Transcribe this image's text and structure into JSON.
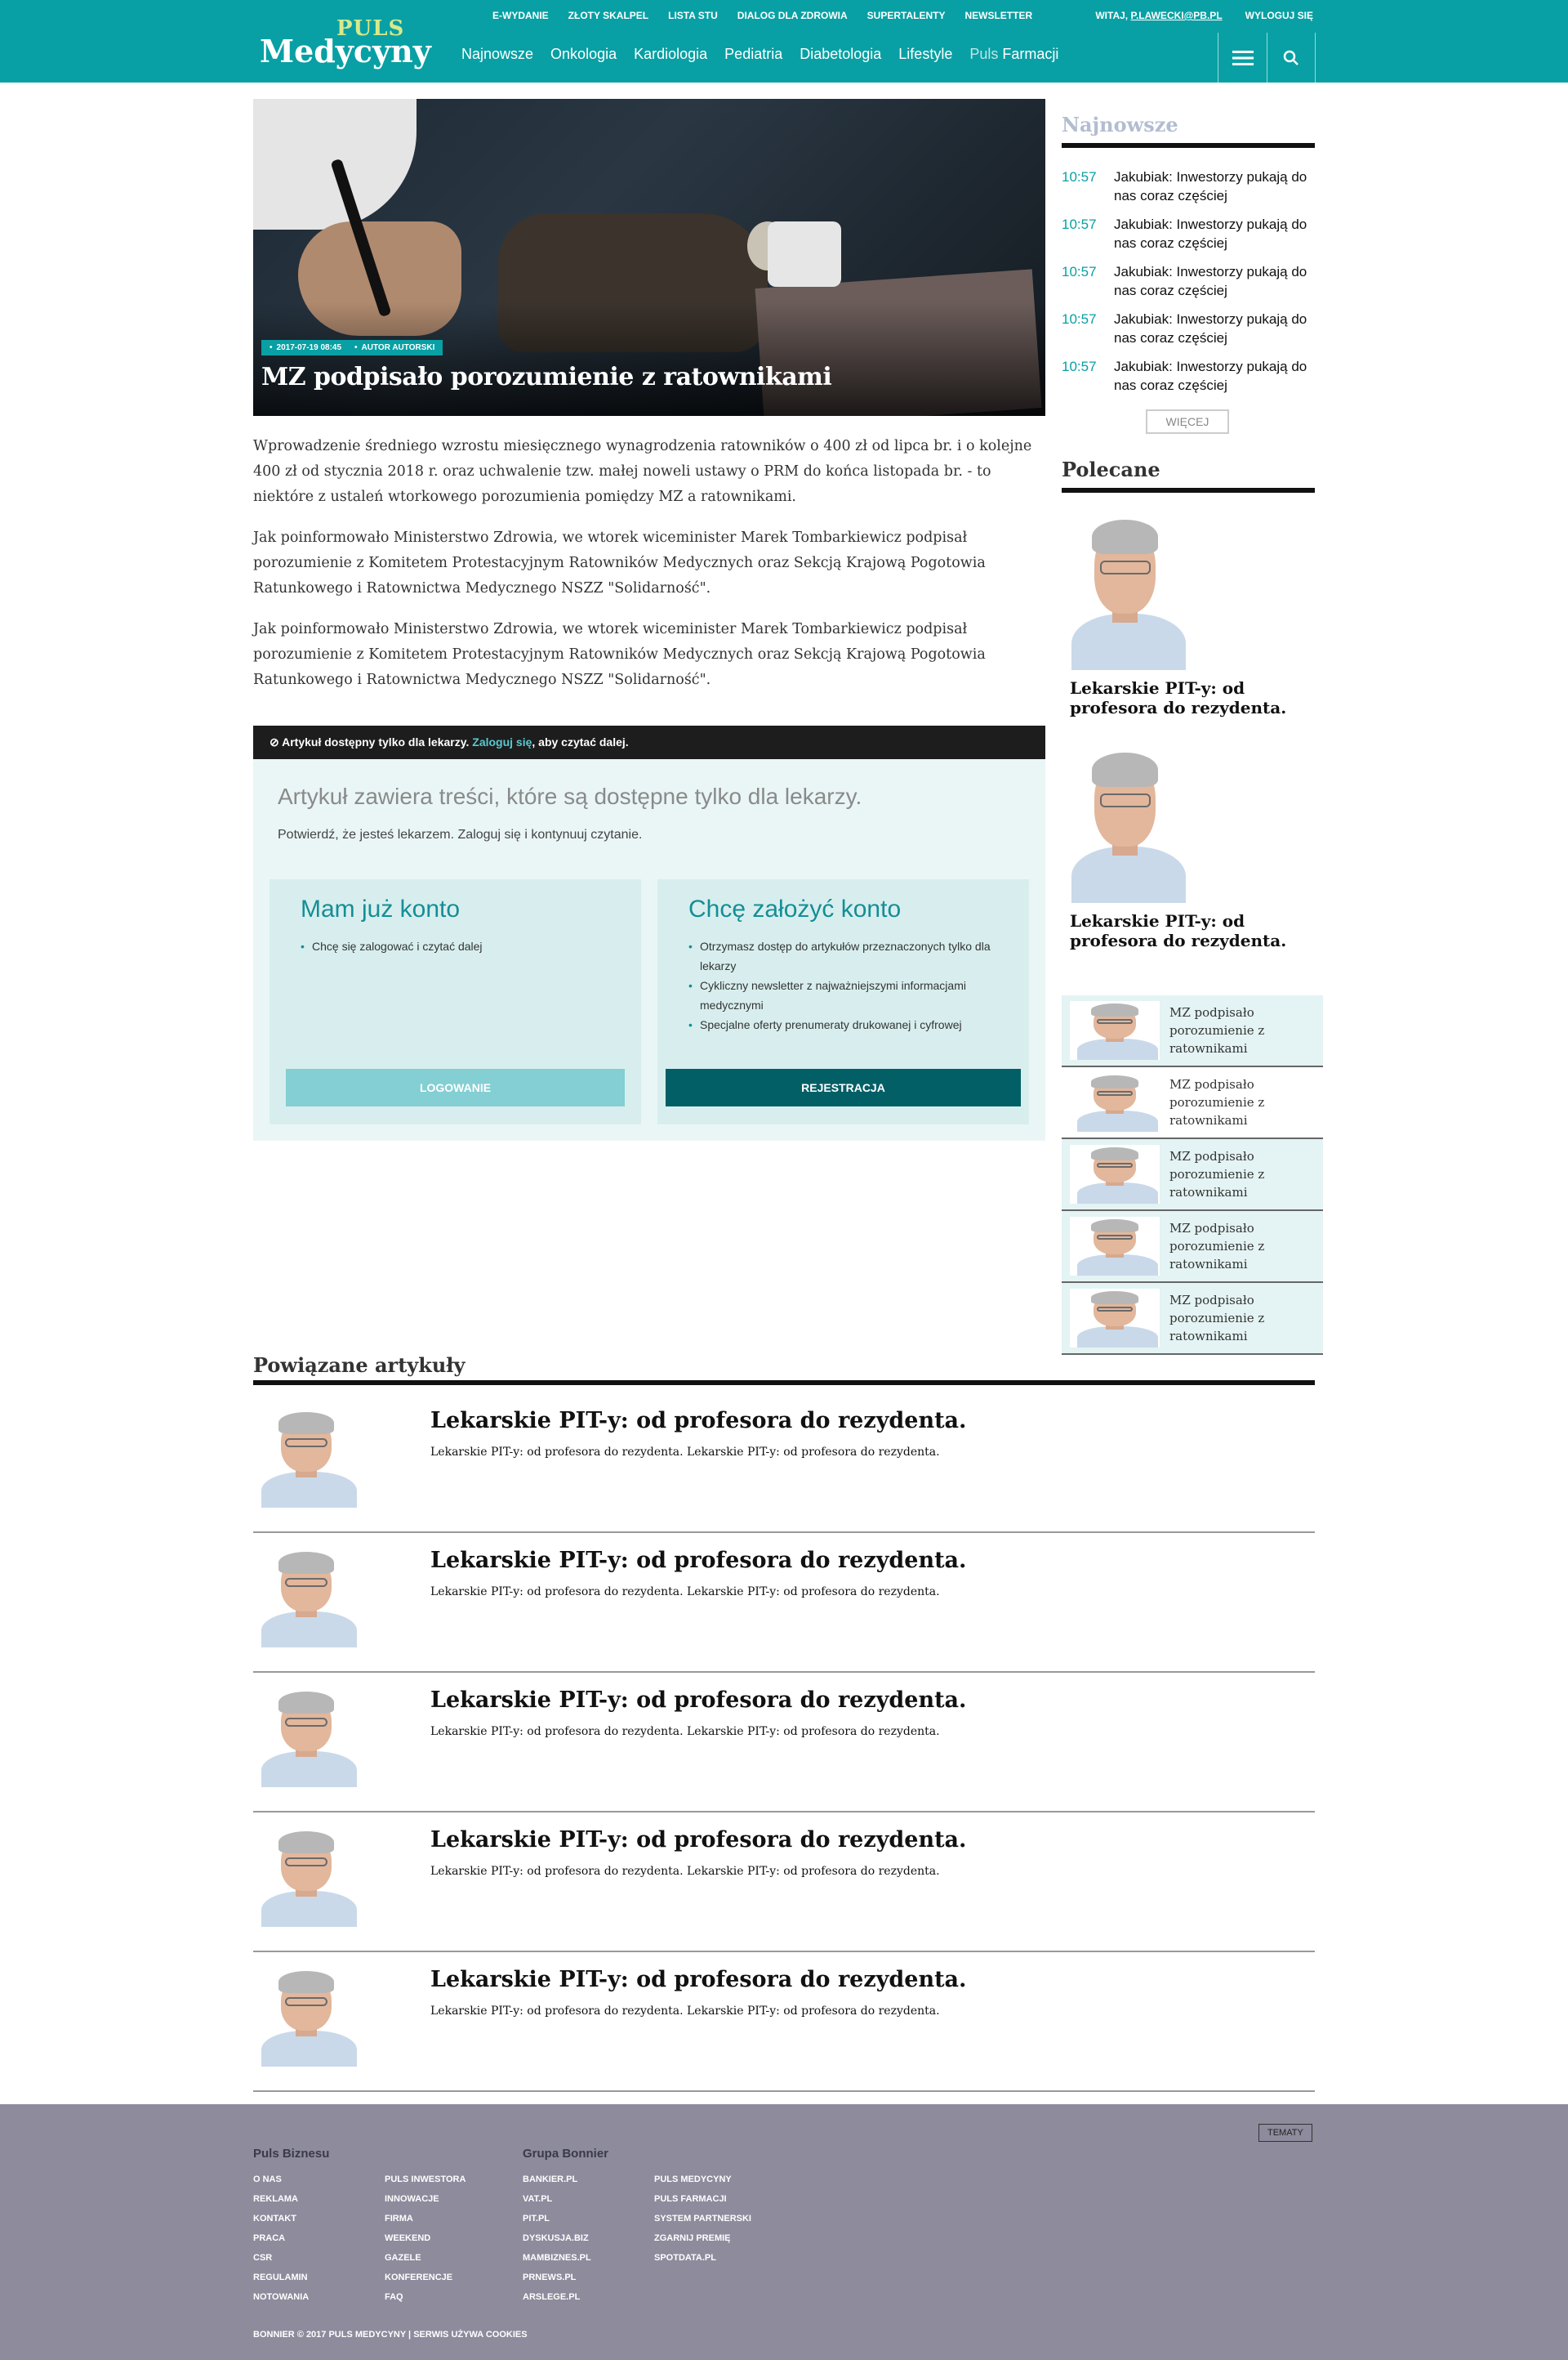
{
  "header": {
    "logo_top": "PULS",
    "logo_main": "Medycyny",
    "top_links": [
      "E-WYDANIE",
      "ZŁOTY SKALPEL",
      "LISTA STU",
      "DIALOG DLA ZDROWIA",
      "SUPERTALENTY",
      "NEWSLETTER"
    ],
    "greeting": "WITAJ,",
    "email": "P.LAWECKI@PB.PL",
    "logout": "WYLOGUJ SIĘ",
    "main_links": [
      "Najnowsze",
      "Onkologia",
      "Kardiologia",
      "Pediatria",
      "Diabetologia",
      "Lifestyle"
    ],
    "puls_prefix": "Puls",
    "puls_suffix": "Farmacji"
  },
  "hero": {
    "date": "2017-07-19 08:45",
    "author": "AUTOR AUTORSKI",
    "title": "MZ podpisało porozumienie z ratownikami"
  },
  "article": {
    "paragraphs": [
      "Wprowadzenie średniego wzrostu miesięcznego wynagrodzenia ratowników o 400 zł od lipca br. i o kolejne 400 zł od stycznia 2018 r. oraz uchwalenie tzw. małej noweli ustawy o PRM do końca listopada br. - to niektóre z ustaleń wtorkowego porozumienia pomiędzy MZ a ratownikami.",
      "Jak poinformowało Ministerstwo Zdrowia, we wtorek wiceminister Marek Tombarkiewicz podpisał porozumienie z Komitetem Protestacyjnym Ratowników Medycznych oraz Sekcją Krajową Pogotowia Ratunkowego i Ratownictwa Medycznego NSZZ \"Solidarność\".",
      "Jak poinformowało Ministerstwo Zdrowia, we wtorek wiceminister Marek Tombarkiewicz podpisał porozumienie z Komitetem Protestacyjnym Ratowników Medycznych oraz Sekcją Krajową Pogotowia Ratunkowego i Ratownictwa Medycznego NSZZ \"Solidarność\"."
    ]
  },
  "paywall": {
    "bar_prefix": "Artykuł dostępny tylko dla lekarzy.",
    "bar_link": "Zaloguj się",
    "bar_suffix": ", aby czytać dalej.",
    "title": "Artykuł zawiera treści, które są dostępne tylko dla lekarzy.",
    "subtitle": "Potwierdź, że jesteś lekarzem. Zaloguj się i kontynuuj czytanie.",
    "login_col": {
      "title": "Mam już konto",
      "items": [
        "Chcę się zalogować i czytać dalej"
      ],
      "button": "LOGOWANIE"
    },
    "register_col": {
      "title": "Chcę założyć konto",
      "items": [
        "Otrzymasz dostęp do artykułów przeznaczonych tylko dla lekarzy",
        "Cykliczny newsletter z najważniejszymi informacjami medycznymi",
        "Specjalne oferty prenumeraty drukowanej i cyfrowej"
      ],
      "button": "REJESTRACJA"
    }
  },
  "sidebar": {
    "newest_title": "Najnowsze",
    "news": [
      {
        "time": "10:57",
        "text": "Jakubiak: Inwestorzy pukają do nas coraz częściej"
      },
      {
        "time": "10:57",
        "text": "Jakubiak: Inwestorzy pukają do nas coraz częściej"
      },
      {
        "time": "10:57",
        "text": "Jakubiak: Inwestorzy pukają do nas coraz częściej"
      },
      {
        "time": "10:57",
        "text": "Jakubiak: Inwestorzy pukają do nas coraz częściej"
      },
      {
        "time": "10:57",
        "text": "Jakubiak: Inwestorzy pukają do nas coraz częściej"
      }
    ],
    "more": "WIĘCEJ",
    "recommended_title": "Polecane",
    "recommended": [
      "Lekarskie PIT-y: od profesora do rezydenta.",
      "Lekarskie PIT-y: od profesora do rezydenta."
    ],
    "mini": [
      "MZ podpisało porozumienie z ratownikami",
      "MZ podpisało porozumienie z ratownikami",
      "MZ podpisało porozumienie z ratownikami",
      "MZ podpisało porozumienie z ratownikami",
      "MZ podpisało porozumienie z ratownikami"
    ]
  },
  "related": {
    "title": "Powiązane artykuły",
    "items": [
      {
        "title": "Lekarskie PIT-y: od profesora do rezydenta.",
        "desc": "Lekarskie PIT-y: od profesora do rezydenta. Lekarskie PIT-y: od profesora do rezydenta."
      },
      {
        "title": "Lekarskie PIT-y: od profesora do rezydenta.",
        "desc": "Lekarskie PIT-y: od profesora do rezydenta. Lekarskie PIT-y: od profesora do rezydenta."
      },
      {
        "title": "Lekarskie PIT-y: od profesora do rezydenta.",
        "desc": "Lekarskie PIT-y: od profesora do rezydenta. Lekarskie PIT-y: od profesora do rezydenta."
      },
      {
        "title": "Lekarskie PIT-y: od profesora do rezydenta.",
        "desc": "Lekarskie PIT-y: od profesora do rezydenta. Lekarskie PIT-y: od profesora do rezydenta."
      },
      {
        "title": "Lekarskie PIT-y: od profesora do rezydenta.",
        "desc": "Lekarskie PIT-y: od profesora do rezydenta. Lekarskie PIT-y: od profesora do rezydenta."
      }
    ]
  },
  "footer": {
    "topics": "TEMATY",
    "col1_title": "Puls Biznesu",
    "col1a": [
      "O NAS",
      "REKLAMA",
      "KONTAKT",
      "PRACA",
      "CSR",
      "REGULAMIN",
      "NOTOWANIA"
    ],
    "col1b": [
      "PULS INWESTORA",
      "INNOWACJE",
      "FIRMA",
      "WEEKEND",
      "GAZELE",
      "KONFERENCJE",
      "FAQ"
    ],
    "col2_title": "Grupa Bonnier",
    "col2a": [
      "BANKIER.PL",
      "VAT.PL",
      "PIT.PL",
      "DYSKUSJA.BIZ",
      "MAMBIZNES.PL",
      "PRNEWS.PL",
      "ARSLEGE.PL"
    ],
    "col2b": [
      "PULS MEDYCYNY",
      "PULS FARMACJI",
      "SYSTEM PARTNERSKI",
      "ZGARNIJ PREMIĘ",
      "SPOTDATA.PL"
    ],
    "copyright": "BONNIER © 2017 PULS MEDYCYNY | SERWIS UŻYWA COOKIES"
  },
  "colors": {
    "brand": "#08a0a4",
    "dark_teal": "#035f66",
    "light_teal": "#83cfd3",
    "footer": "#8d8b9c"
  },
  "icons": [
    "menu-icon",
    "search-icon",
    "lock-icon"
  ]
}
